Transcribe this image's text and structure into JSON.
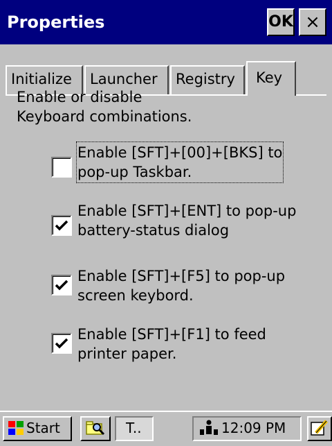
{
  "window": {
    "title": "Properties",
    "ok_label": "OK",
    "close_label": "×"
  },
  "tabs": [
    {
      "label": "Initialize",
      "active": false
    },
    {
      "label": "Launcher",
      "active": false
    },
    {
      "label": "Registry",
      "active": false
    },
    {
      "label": "Key",
      "active": true
    }
  ],
  "description": [
    "Enable or disable",
    "Keyboard combinations."
  ],
  "options": [
    {
      "lines": [
        "Enable [SFT]+[00]+[BKS] to",
        "pop-up Taskbar."
      ],
      "checked": false
    },
    {
      "lines": [
        "Enable [SFT]+[ENT] to pop-up",
        "battery-status dialog"
      ],
      "checked": true
    },
    {
      "lines": [
        "Enable [SFT]+[F5] to pop-up",
        "screen keybord."
      ],
      "checked": true
    },
    {
      "lines": [
        "Enable [SFT]+[F1] to feed",
        "printer paper."
      ],
      "checked": true
    }
  ],
  "taskbar": {
    "start_label": "Start",
    "task_label": "T..",
    "clock": "12:09 PM"
  },
  "colors": {
    "titlebar": "#00007f",
    "face": "#c0c0c0"
  }
}
